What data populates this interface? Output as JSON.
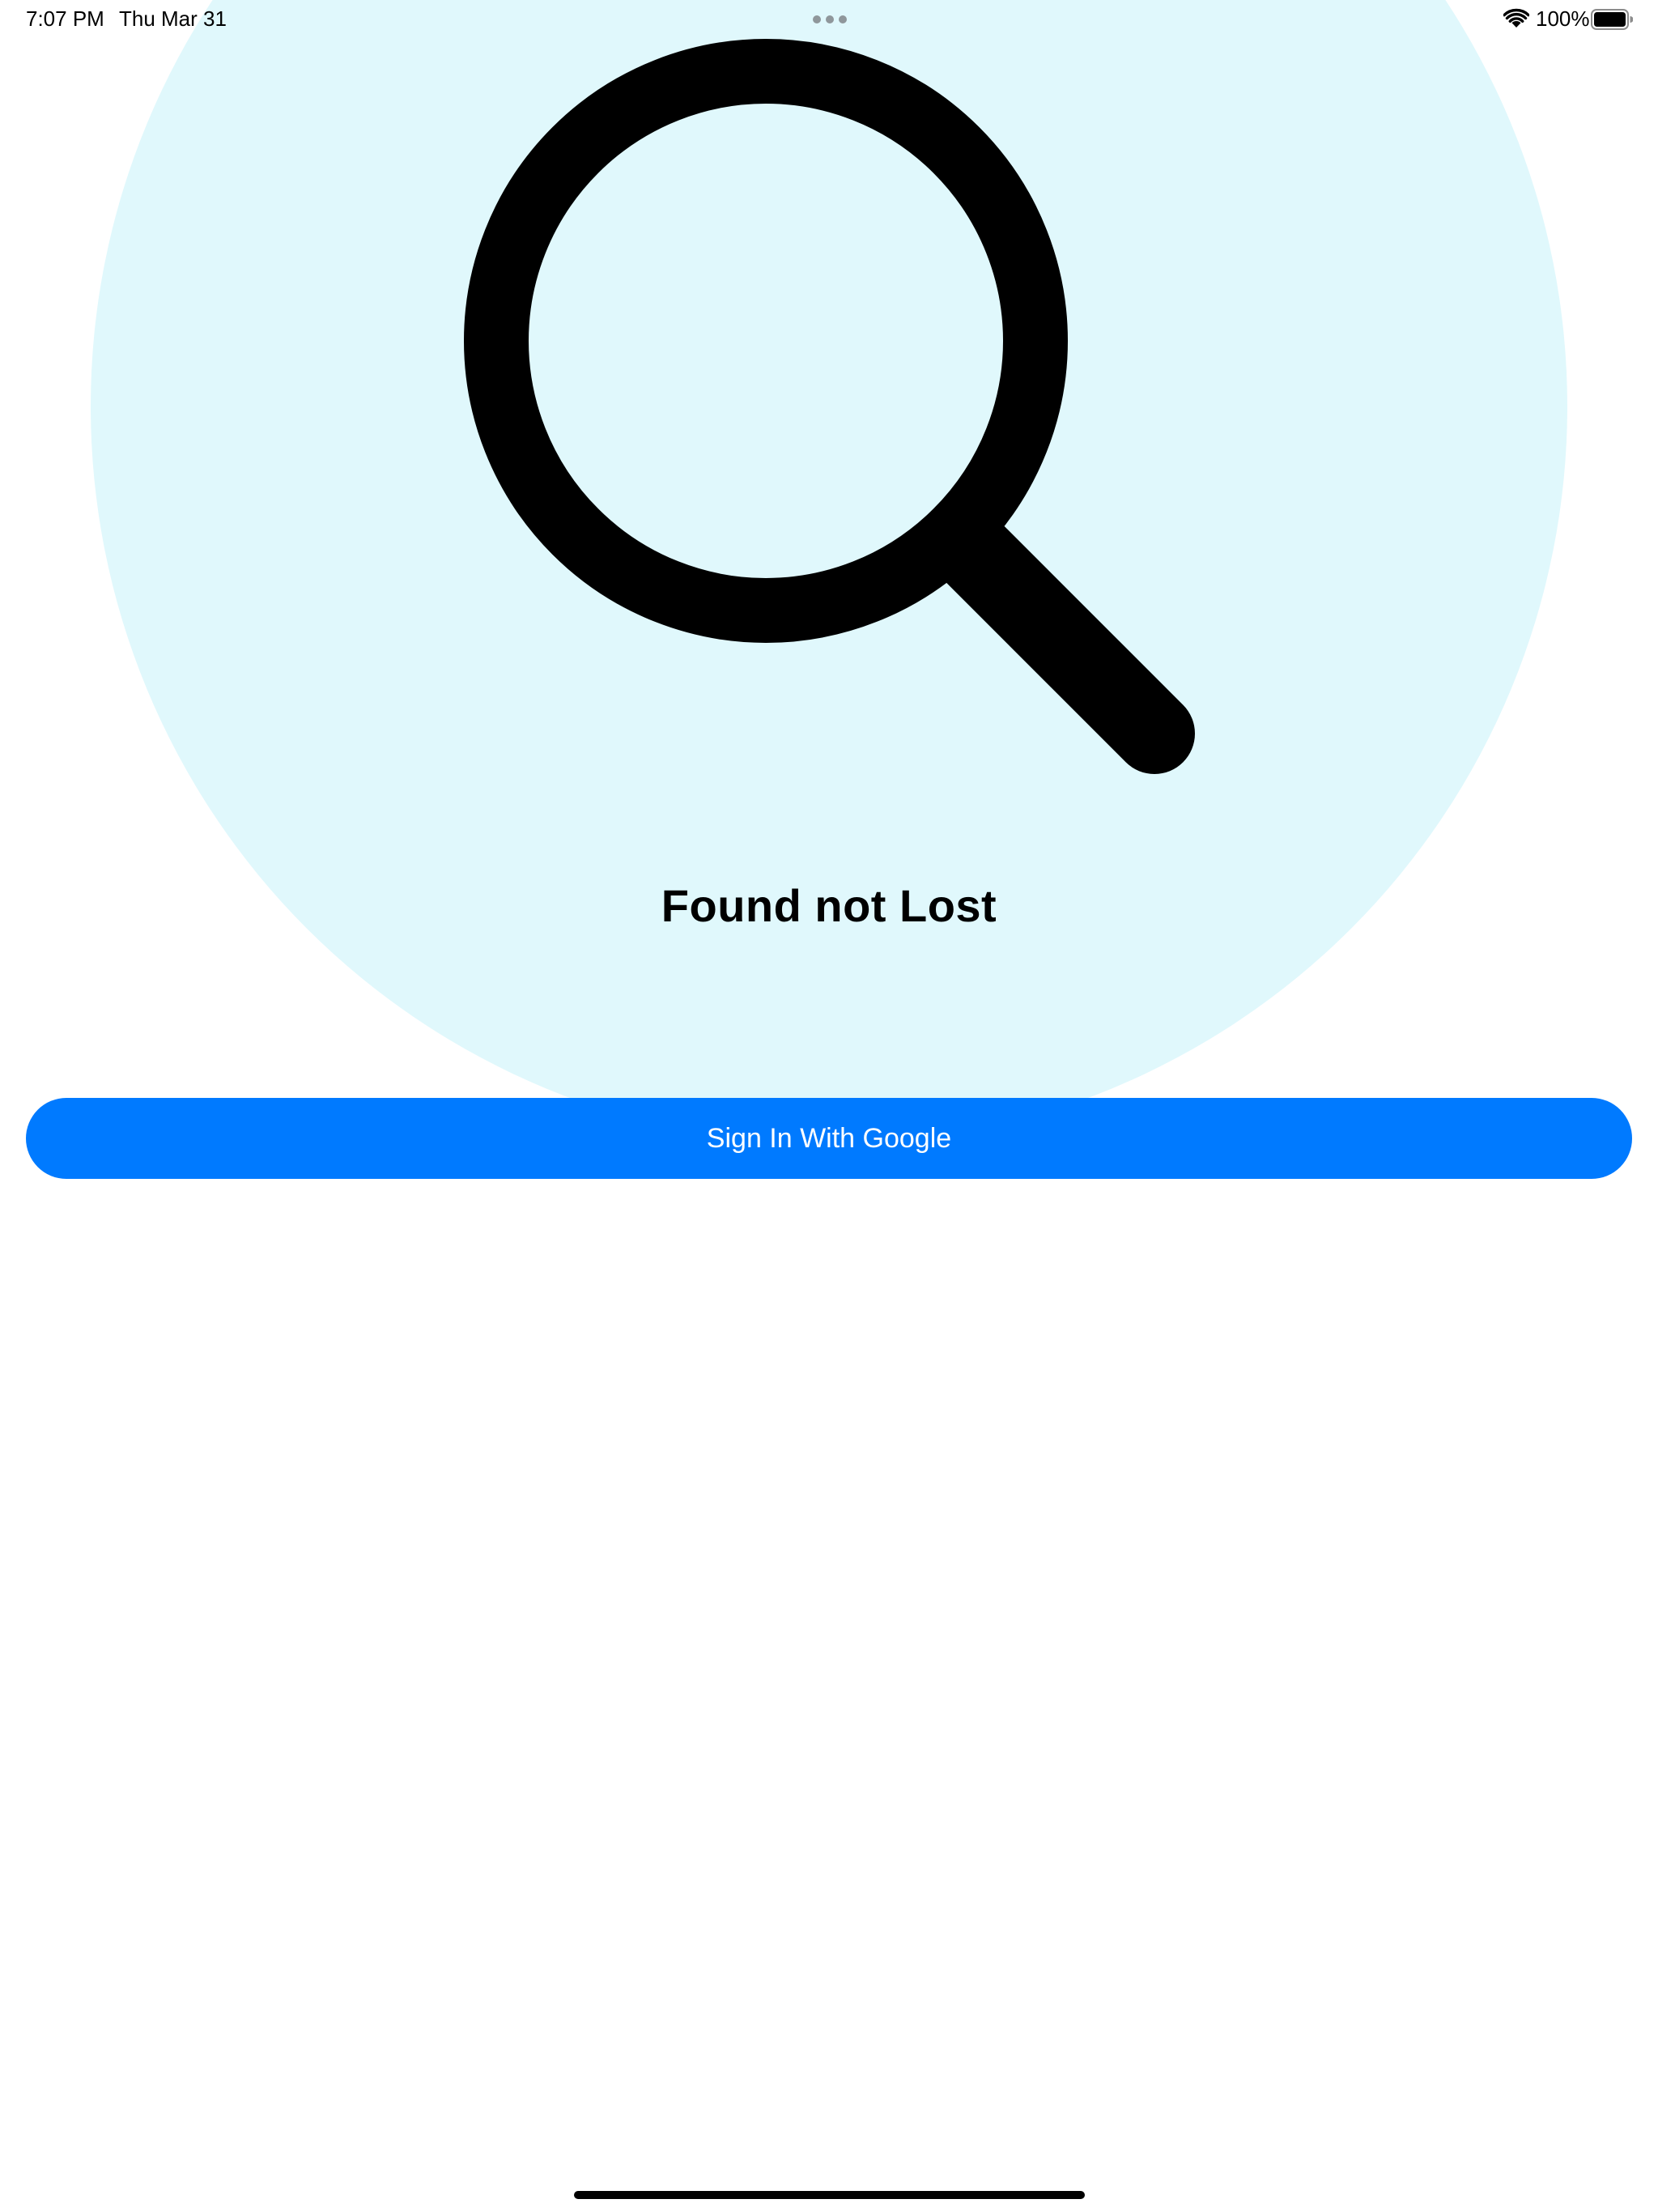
{
  "status_bar": {
    "time": "7:07 PM",
    "date": "Thu Mar 31",
    "battery_percent": "100%",
    "wifi_icon": "wifi-icon",
    "battery_icon": "battery-full-icon",
    "battery_level": 1.0
  },
  "hero": {
    "icon": "magnifying-glass-icon",
    "background_color": "#e0f8fc"
  },
  "main": {
    "title": "Found not Lost",
    "sign_in_button_label": "Sign In With Google",
    "button_color": "#007aff"
  }
}
